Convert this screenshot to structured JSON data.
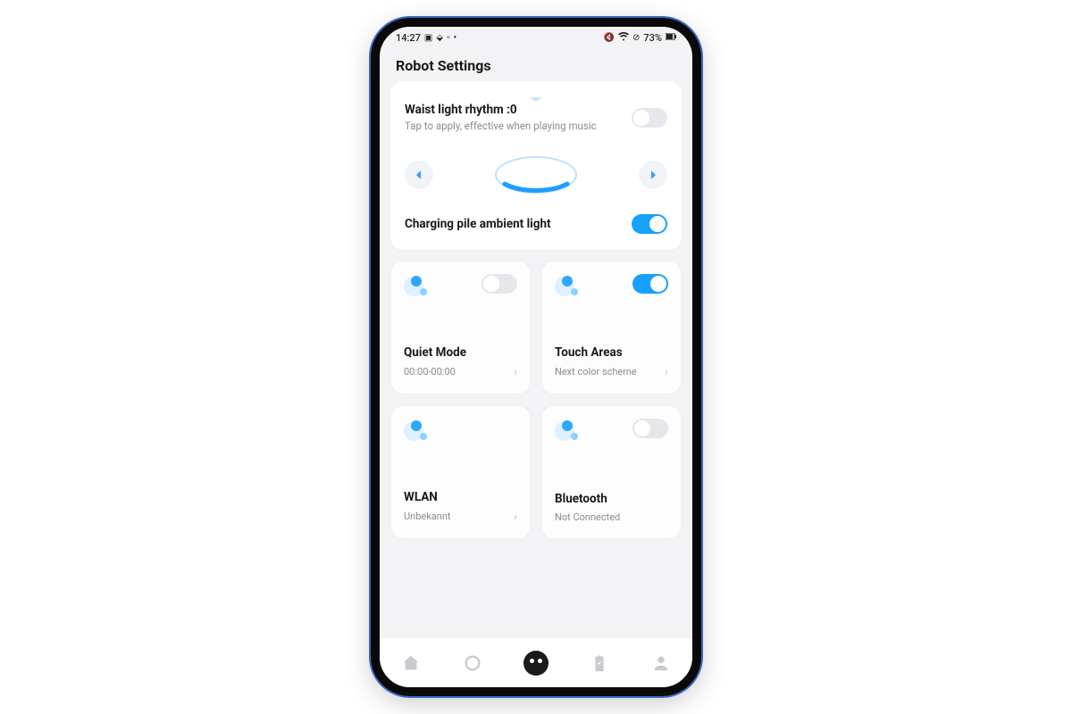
{
  "statusbar": {
    "time": "14:27",
    "battery": "73%"
  },
  "header": {
    "title": "Robot Settings"
  },
  "card1": {
    "waist_label": "Waist light rhythm :0",
    "waist_sub": "Tap to apply, effective when playing music",
    "charging_label": "Charging pile ambient light"
  },
  "tiles": {
    "quiet": {
      "title": "Quiet Mode",
      "sub": "00:00-00:00"
    },
    "touch": {
      "title": "Touch Areas",
      "sub": "Next color scheme"
    },
    "wlan": {
      "title": "WLAN",
      "sub": "Unbekannt"
    },
    "bt": {
      "title": "Bluetooth",
      "sub": "Not Connected"
    }
  }
}
